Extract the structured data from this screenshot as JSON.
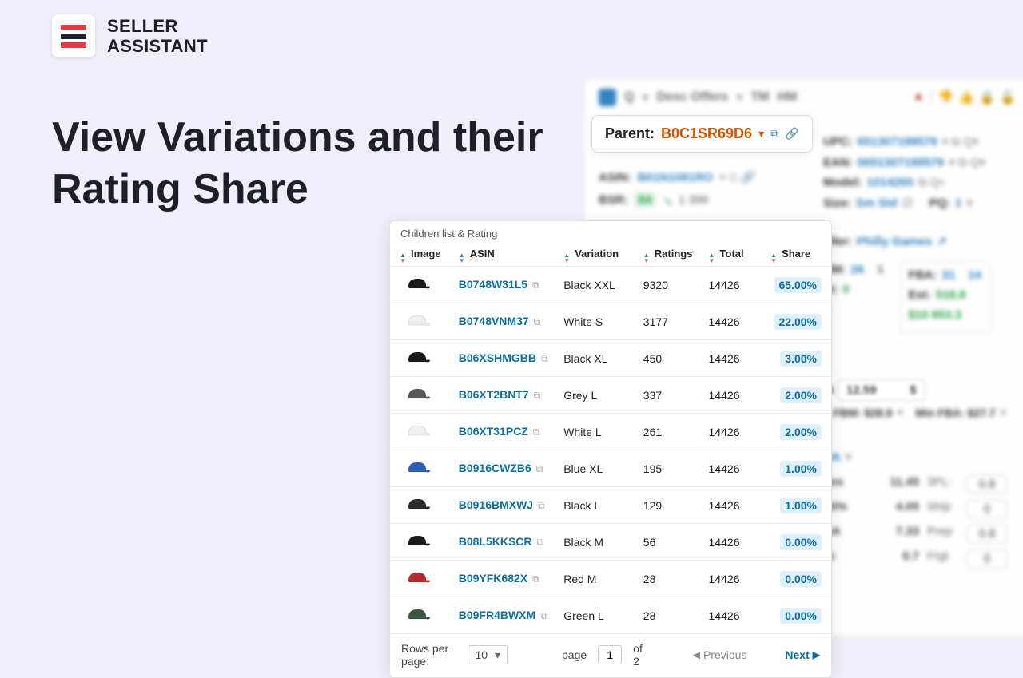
{
  "brand": {
    "line1": "SELLER",
    "line2": "ASSISTANT"
  },
  "headline": "View Variations and their Rating Share",
  "parent": {
    "label": "Parent:",
    "value": "B0C1SR69D6"
  },
  "bg": {
    "q": "Q",
    "desc": "Desc Offers",
    "tm": "TM",
    "hm": "HM",
    "asin_l": "ASIN:",
    "asin_v": "B01N1081RO",
    "bsr_l": "BSR:",
    "bsr_v": "84",
    "bsr_n": "1 396",
    "upc_l": "UPC:",
    "upc_v": "651307199579",
    "ean_l": "EAN:",
    "ean_v": "0651307199579",
    "model_l": "Model:",
    "model_v": "1014265",
    "size_l": "Size:",
    "size_v": "Sm Std",
    "pq_l": "PQ:",
    "pq_v": "1",
    "seller_l": "eller:",
    "seller_v": "Philly Games",
    "bm_l": "BM:",
    "bm_v": "26",
    "bm_n": "1",
    "st_l": "st:",
    "st_v": "0",
    "fba_l": "FBA:",
    "fba_v1": "31",
    "fba_v2": "14",
    "est_l": "Est:",
    "est_v": "518.8",
    "est_v2": "$10 853.3",
    "min_fbm": "n FBM: $28.9",
    "min_fba": "Min FBA: $27.7",
    "cog_l": "DG",
    "cog_v": "12.59",
    "cog_cur": "$",
    "fee_rows": [
      {
        "a": "ees",
        "b": "11.45",
        "c": "3PL:",
        "d": "0.8"
      },
      {
        "a": "15%",
        "b": "4.05",
        "c": "Ship",
        "d": "0"
      },
      {
        "a": "BA",
        "b": "7.33",
        "c": "Prep",
        "d": "0.8"
      },
      {
        "a": "to",
        "b": "0.7",
        "c": "Frgt",
        "d": "0"
      }
    ],
    "ba_dd": "BA"
  },
  "table": {
    "title": "Children list & Rating",
    "cols": {
      "img": "Image",
      "asin": "ASIN",
      "var": "Variation",
      "rat": "Ratings",
      "tot": "Total",
      "shr": "Share"
    },
    "rows": [
      {
        "asin": "B0748W31L5",
        "variation": "Black XXL",
        "ratings": "9320",
        "total": "14426",
        "share": "65.00%",
        "cap": "#1a1a1a"
      },
      {
        "asin": "B0748VNM37",
        "variation": "White S",
        "ratings": "3177",
        "total": "14426",
        "share": "22.00%",
        "cap": "#f0f0f0"
      },
      {
        "asin": "B06XSHMGBB",
        "variation": "Black XL",
        "ratings": "450",
        "total": "14426",
        "share": "3.00%",
        "cap": "#1a1a1a"
      },
      {
        "asin": "B06XT2BNT7",
        "variation": "Grey L",
        "ratings": "337",
        "total": "14426",
        "share": "2.00%",
        "cap": "#58595b"
      },
      {
        "asin": "B06XT31PCZ",
        "variation": "White L",
        "ratings": "261",
        "total": "14426",
        "share": "2.00%",
        "cap": "#f0f0f0"
      },
      {
        "asin": "B0916CWZB6",
        "variation": "Blue XL",
        "ratings": "195",
        "total": "14426",
        "share": "1.00%",
        "cap": "#2b5db8"
      },
      {
        "asin": "B0916BMXWJ",
        "variation": "Black L",
        "ratings": "129",
        "total": "14426",
        "share": "1.00%",
        "cap": "#2b2b2b"
      },
      {
        "asin": "B08L5KKSCR",
        "variation": "Black M",
        "ratings": "56",
        "total": "14426",
        "share": "0.00%",
        "cap": "#1a1a1a"
      },
      {
        "asin": "B09YFK682X",
        "variation": "Red M",
        "ratings": "28",
        "total": "14426",
        "share": "0.00%",
        "cap": "#b8292f"
      },
      {
        "asin": "B09FR4BWXM",
        "variation": "Green L",
        "ratings": "28",
        "total": "14426",
        "share": "0.00%",
        "cap": "#3b5540"
      }
    ]
  },
  "pager": {
    "rpp_label": "Rows per page:",
    "rpp_value": "10",
    "page_label": "page",
    "page_value": "1",
    "total_pages": "of 2",
    "prev": "Previous",
    "next": "Next"
  }
}
